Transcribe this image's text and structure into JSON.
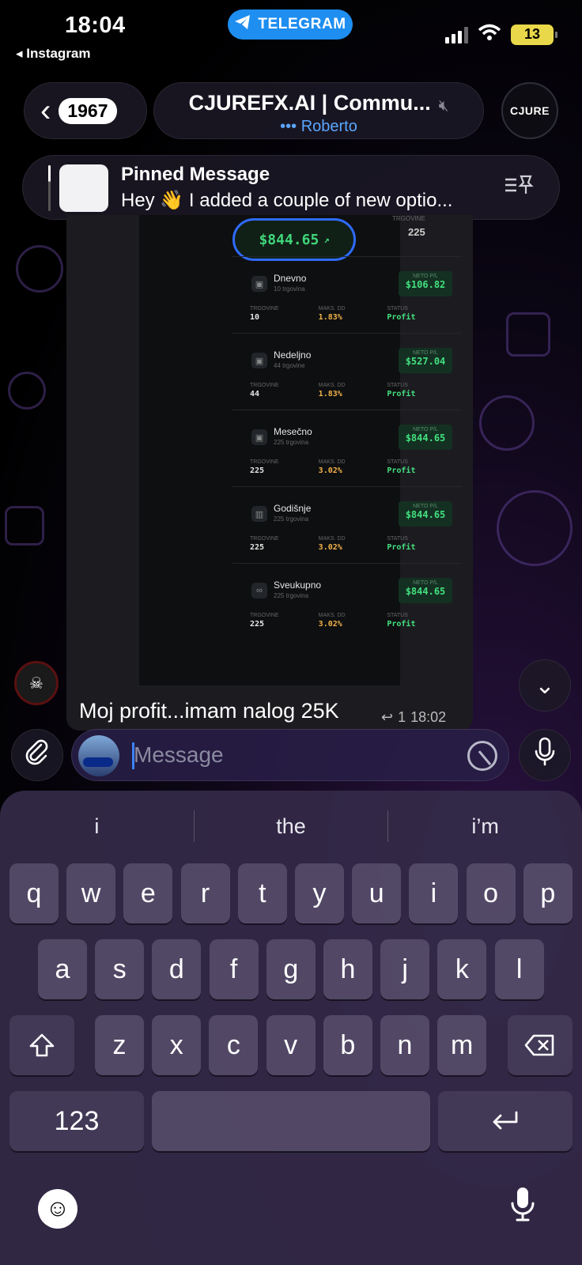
{
  "status_bar": {
    "time": "18:04",
    "back_app": "◂ Instagram",
    "pill_label": "TELEGRAM",
    "battery": "13",
    "icons": [
      "signal-icon",
      "wifi-icon",
      "battery-icon",
      "telegram-icon"
    ]
  },
  "header": {
    "back_count": "1967",
    "title": "CJUREFX.AI | Commu...",
    "typing": "••• Roberto",
    "avatar_text": "CJURE"
  },
  "pinned": {
    "title": "Pinned Message",
    "text": "Hey 👋 I added a couple of new optio..."
  },
  "message": {
    "screenshot": {
      "total": "$844.65",
      "top_label": "TRGOVINE",
      "top_count": "225",
      "stat_labels": {
        "trades": "TRGOVINE",
        "dd": "MAKS. DD",
        "status": "STATUS",
        "neto": "NETO P/L"
      },
      "periods": [
        {
          "name": "Dnevno",
          "sub": "10 trgovina",
          "neto": "$106.82",
          "trades": "10",
          "dd": "1.83%",
          "status": "Profit"
        },
        {
          "name": "Nedeljno",
          "sub": "44 trgovine",
          "neto": "$527.04",
          "trades": "44",
          "dd": "1.83%",
          "status": "Profit"
        },
        {
          "name": "Mesečno",
          "sub": "225 trgovina",
          "neto": "$844.65",
          "trades": "225",
          "dd": "3.02%",
          "status": "Profit"
        },
        {
          "name": "Godišnje",
          "sub": "225 trgovina",
          "neto": "$844.65",
          "trades": "225",
          "dd": "3.02%",
          "status": "Profit"
        },
        {
          "name": "Sveukupno",
          "sub": "225 trgovina",
          "neto": "$844.65",
          "trades": "225",
          "dd": "3.02%",
          "status": "Profit"
        }
      ]
    },
    "caption": "Moj profit...imam nalog 25K",
    "reply_count": "1",
    "time": "18:02"
  },
  "input": {
    "placeholder": "Message"
  },
  "keyboard": {
    "suggestions": [
      "i",
      "the",
      "i’m"
    ],
    "row1": [
      "q",
      "w",
      "e",
      "r",
      "t",
      "y",
      "u",
      "i",
      "o",
      "p"
    ],
    "row2": [
      "a",
      "s",
      "d",
      "f",
      "g",
      "h",
      "j",
      "k",
      "l"
    ],
    "row3": [
      "z",
      "x",
      "c",
      "v",
      "b",
      "n",
      "m"
    ],
    "numbers_key": "123"
  },
  "colors": {
    "accent": "#2f6bff",
    "profit_green": "#43e07f",
    "dd_orange": "#f2b24a",
    "telegram_blue": "#1e8ef0"
  }
}
